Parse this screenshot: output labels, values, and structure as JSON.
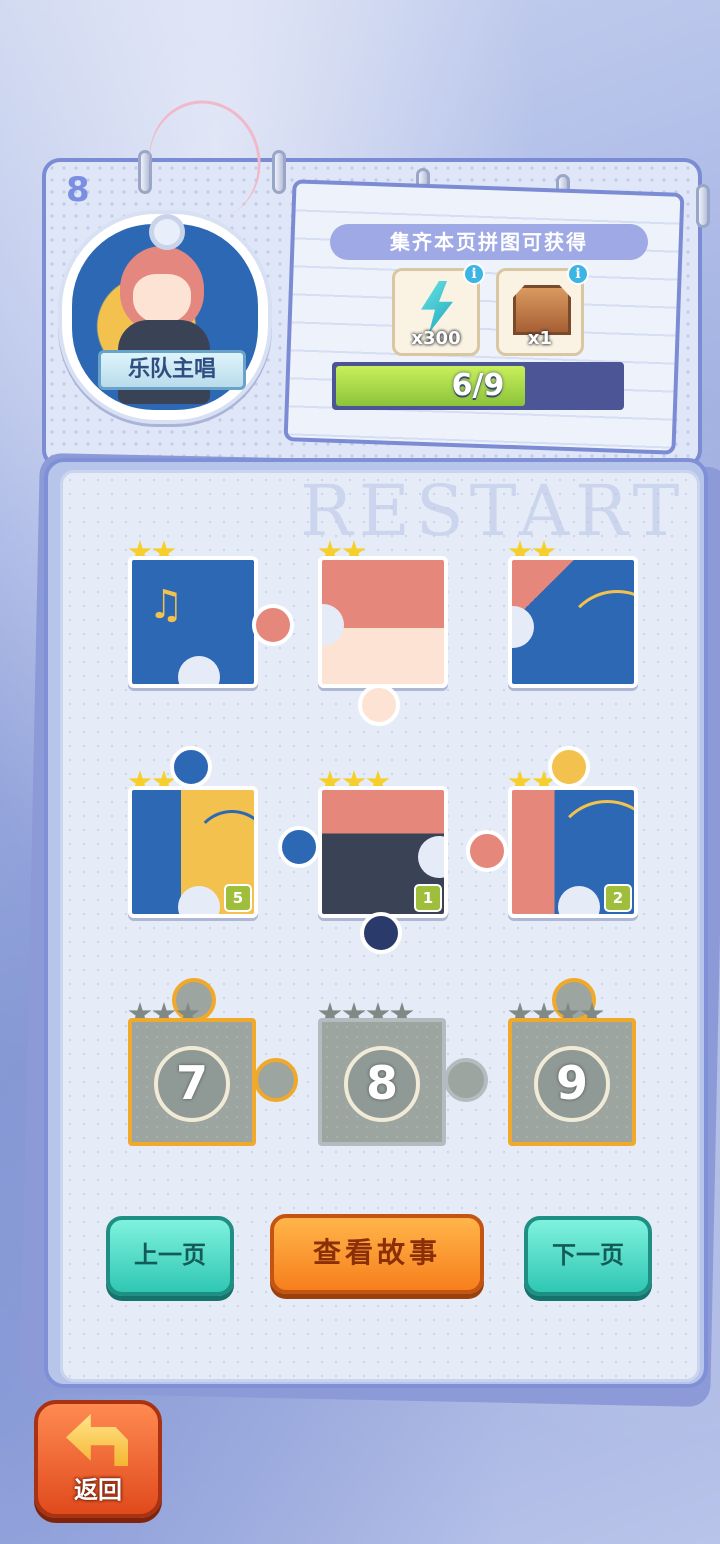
{
  "header": {
    "page_number": "8",
    "character_name": "乐队主唱"
  },
  "reward": {
    "title": "集齐本页拼图可获得",
    "items": [
      {
        "icon": "energy-bolt-icon",
        "quantity": "x300"
      },
      {
        "icon": "treasure-chest-icon",
        "quantity": "x1"
      }
    ],
    "info_glyph": "i",
    "progress_text": "6/9",
    "progress_fraction": 0.667
  },
  "watermark": "RESTART",
  "pieces": [
    {
      "index": 1,
      "stars": 2,
      "max_stars": 2,
      "collected": true
    },
    {
      "index": 2,
      "stars": 2,
      "max_stars": 2,
      "collected": true
    },
    {
      "index": 3,
      "stars": 2,
      "max_stars": 2,
      "collected": true
    },
    {
      "index": 4,
      "stars": 3,
      "max_stars": 3,
      "collected": true,
      "count": "5"
    },
    {
      "index": 5,
      "stars": 3,
      "max_stars": 3,
      "collected": true,
      "count": "1"
    },
    {
      "index": 6,
      "stars": 3,
      "max_stars": 3,
      "collected": true,
      "count": "2"
    },
    {
      "index": 7,
      "stars": 3,
      "max_stars": 3,
      "collected": false,
      "label": "7"
    },
    {
      "index": 8,
      "stars": 4,
      "max_stars": 4,
      "collected": false,
      "label": "8"
    },
    {
      "index": 9,
      "stars": 4,
      "max_stars": 4,
      "collected": false,
      "label": "9"
    }
  ],
  "buttons": {
    "prev_page": "上一页",
    "view_story": "查看故事",
    "next_page": "下一页",
    "back": "返回"
  },
  "colors": {
    "star_gold": "#f6cf2d",
    "star_locked": "#7f8a86",
    "progress_fill": "#8cc43a",
    "teal_button": "#2fc7b3",
    "orange_button": "#f77f1c",
    "back_button": "#e04a1c"
  }
}
